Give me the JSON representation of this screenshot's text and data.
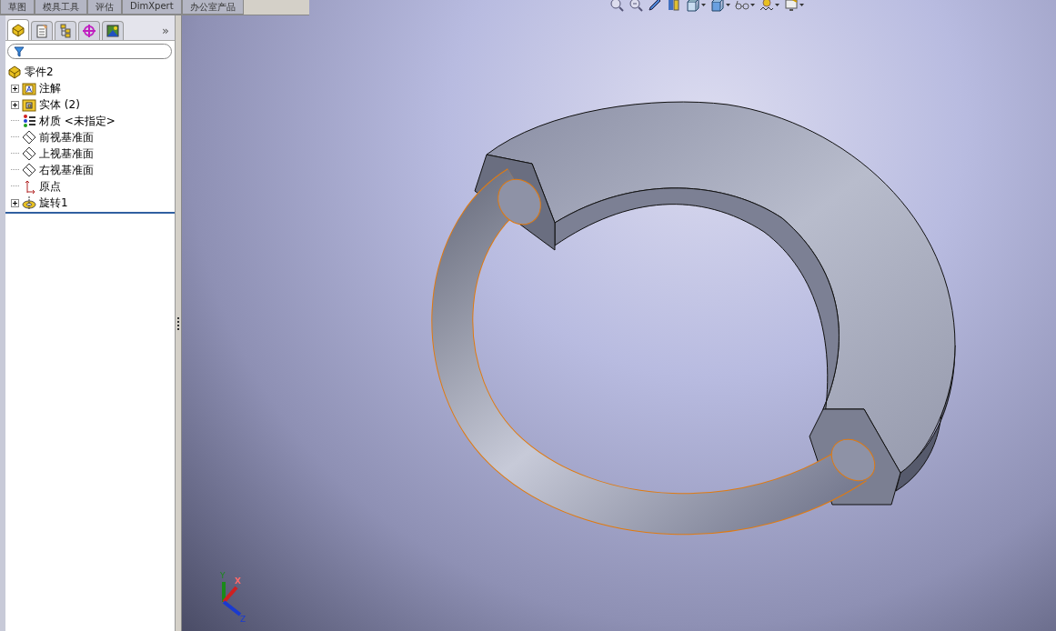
{
  "command_tabs": [
    {
      "label": "草图",
      "selected": false
    },
    {
      "label": "模具工具",
      "selected": false
    },
    {
      "label": "评估",
      "selected": false
    },
    {
      "label": "DimXpert",
      "selected": false
    },
    {
      "label": "办公室产品",
      "selected": false
    }
  ],
  "manager_tabs": [
    {
      "kind": "feature",
      "selected": true
    },
    {
      "kind": "property",
      "selected": false
    },
    {
      "kind": "config",
      "selected": false
    },
    {
      "kind": "dimxpert",
      "selected": false
    },
    {
      "kind": "display",
      "selected": false
    }
  ],
  "manager_more": "»",
  "tree": {
    "label": "零件2",
    "kind": "part",
    "children": [
      {
        "label": "注解",
        "kind": "annotation",
        "expandable": true
      },
      {
        "label": "实体 (2)",
        "kind": "solid",
        "expandable": true
      },
      {
        "label": "材质 <未指定>",
        "kind": "material",
        "expandable": false
      },
      {
        "label": "前视基准面",
        "kind": "plane",
        "expandable": false
      },
      {
        "label": "上视基准面",
        "kind": "plane",
        "expandable": false
      },
      {
        "label": "右视基准面",
        "kind": "plane",
        "expandable": false
      },
      {
        "label": "原点",
        "kind": "origin",
        "expandable": false
      },
      {
        "label": "旋转1",
        "kind": "revolve",
        "expandable": true
      }
    ]
  },
  "view_toolbar": [
    {
      "kind": "zoom-fit",
      "dropdown": false
    },
    {
      "kind": "zoom-area",
      "dropdown": false
    },
    {
      "kind": "previous",
      "dropdown": false
    },
    {
      "kind": "section",
      "dropdown": false
    },
    {
      "kind": "orientation",
      "dropdown": true
    },
    {
      "kind": "display",
      "dropdown": true
    },
    {
      "kind": "hide-show",
      "dropdown": true
    },
    {
      "kind": "scene",
      "dropdown": true
    },
    {
      "kind": "settings",
      "dropdown": true
    }
  ],
  "triad": {
    "y": "Y",
    "x": "X",
    "z": "Z"
  }
}
